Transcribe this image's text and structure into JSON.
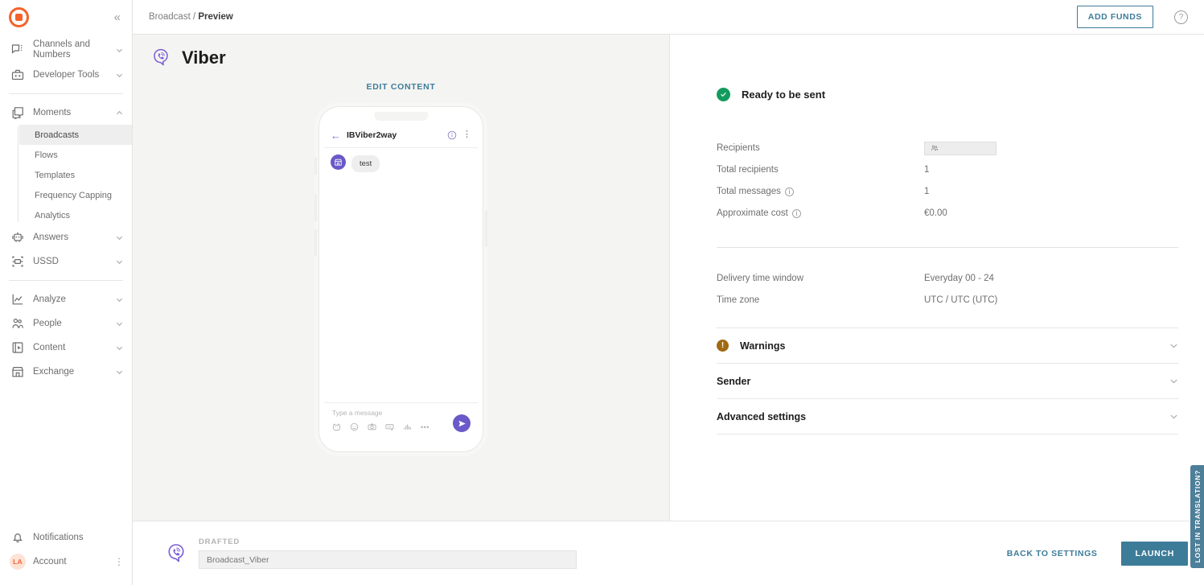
{
  "sidebar": {
    "logo_icon": "target-logo-icon",
    "collapse_icon": "chevron-double-left-icon",
    "groups": [
      {
        "items": [
          {
            "label": "Channels and Numbers",
            "icon": "chat-numbers-icon",
            "chevron": "down",
            "expanded": false
          },
          {
            "label": "Developer Tools",
            "icon": "toolbox-code-icon",
            "chevron": "down",
            "expanded": false
          }
        ]
      },
      {
        "items": [
          {
            "label": "Moments",
            "icon": "layers-icon",
            "chevron": "up",
            "expanded": true,
            "sub_items": [
              {
                "label": "Broadcasts",
                "active": true
              },
              {
                "label": "Flows",
                "active": false
              },
              {
                "label": "Templates",
                "active": false
              },
              {
                "label": "Frequency Capping",
                "active": false
              },
              {
                "label": "Analytics",
                "active": false
              }
            ]
          },
          {
            "label": "Answers",
            "icon": "robot-icon",
            "chevron": "down",
            "expanded": false
          },
          {
            "label": "USSD",
            "icon": "ussd-icon",
            "chevron": "down",
            "expanded": false
          }
        ]
      },
      {
        "items": [
          {
            "label": "Analyze",
            "icon": "chart-line-icon",
            "chevron": "down",
            "expanded": false
          },
          {
            "label": "People",
            "icon": "people-icon",
            "chevron": "down",
            "expanded": false
          },
          {
            "label": "Content",
            "icon": "content-icon",
            "chevron": "down",
            "expanded": false
          },
          {
            "label": "Exchange",
            "icon": "storefront-icon",
            "chevron": "down",
            "expanded": false
          }
        ]
      }
    ],
    "bottom": {
      "notifications_label": "Notifications",
      "notifications_icon": "bell-icon",
      "account_label": "Account",
      "account_initials": "LA",
      "account_menu_icon": "kebab-menu-icon"
    },
    "active_indicator_color": "#f4622a"
  },
  "topbar": {
    "breadcrumb_root": "Broadcast",
    "breadcrumb_sep": " / ",
    "breadcrumb_current": "Preview",
    "add_funds_label": "ADD FUNDS",
    "help_icon": "question-mark-circle-icon",
    "accent_color": "#3d7c99"
  },
  "preview": {
    "channel_name": "Viber",
    "channel_icon": "viber-logo-icon",
    "edit_content_label": "EDIT CONTENT",
    "phone": {
      "chat_name": "IBViber2way",
      "back_icon": "arrow-left-icon",
      "info_icon": "info-circle-icon",
      "menu_icon": "kebab-menu-icon",
      "message_text": "test",
      "message_avatar_icon": "storefront-icon",
      "input_placeholder": "Type a message",
      "tool_icons": [
        "sticker-icon",
        "emoji-icon",
        "camera-icon",
        "gif-icon",
        "audio-waveform-icon"
      ],
      "more_icon": "more-dots-icon",
      "send_icon": "send-paper-plane-icon"
    }
  },
  "settings": {
    "status_label": "Ready to be sent",
    "status_icon": "check-circle-icon",
    "status_color": "#139b5e",
    "rows": [
      {
        "label": "Recipients",
        "value": "",
        "has_info": false,
        "has_chip": true,
        "chip_icon": "group-people-icon"
      },
      {
        "label": "Total recipients",
        "value": "1",
        "has_info": false,
        "has_chip": false
      },
      {
        "label": "Total messages",
        "value": "1",
        "has_info": true,
        "has_chip": false
      },
      {
        "label": "Approximate cost",
        "value": "€0.00",
        "has_info": true,
        "has_chip": false
      }
    ],
    "rows2": [
      {
        "label": "Delivery time window",
        "value": "Everyday 00 - 24",
        "has_info": false
      },
      {
        "label": "Time zone",
        "value": "UTC / UTC (UTC)",
        "has_info": false
      }
    ],
    "accordions": [
      {
        "title": "Warnings",
        "icon": "warning-exclamation-icon",
        "icon_char": "!",
        "icon_color": "#a06a12",
        "chevron": "chevron-down-icon"
      },
      {
        "title": "Sender",
        "icon": null,
        "chevron": "chevron-down-icon"
      },
      {
        "title": "Advanced settings",
        "icon": null,
        "chevron": "chevron-down-icon"
      }
    ]
  },
  "bottombar": {
    "status_label": "DRAFTED",
    "channel_icon": "viber-logo-icon",
    "name_value": "Broadcast_Viber",
    "name_placeholder": "Broadcast_Viber",
    "back_label": "BACK TO SETTINGS",
    "launch_label": "LAUNCH",
    "launch_color": "#3d7c99"
  },
  "side_tab": {
    "label": "LOST IN TRANSLATION?",
    "color": "#4d7f99"
  }
}
